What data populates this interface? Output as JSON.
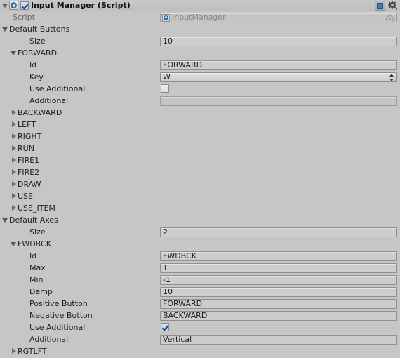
{
  "header": {
    "title": "Input Manager (Script)",
    "enabled": true,
    "foldout_open": true,
    "script_icon": "script-icon",
    "help_icon": "help-icon",
    "gear_icon": "gear-icon"
  },
  "script_row": {
    "label": "Script",
    "value": "InputManager",
    "disabled": true
  },
  "default_buttons": {
    "label": "Default Buttons",
    "size_label": "Size",
    "size_value": "10",
    "expanded_entry": {
      "name": "FORWARD",
      "fields": [
        {
          "label": "Id",
          "value": "FORWARD",
          "type": "text",
          "disabled": false
        },
        {
          "label": "Key",
          "value": "W",
          "type": "popup",
          "disabled": false
        },
        {
          "label": "Use Additional",
          "value": false,
          "type": "checkbox",
          "disabled": false
        },
        {
          "label": "Additional",
          "value": "",
          "type": "text",
          "disabled": true
        }
      ]
    },
    "collapsed_entries": [
      "BACKWARD",
      "LEFT",
      "RIGHT",
      "RUN",
      "FIRE1",
      "FIRE2",
      "DRAW",
      "USE",
      "USE_ITEM"
    ]
  },
  "default_axes": {
    "label": "Default Axes",
    "size_label": "Size",
    "size_value": "2",
    "expanded_entry": {
      "name": "FWDBCK",
      "fields": [
        {
          "label": "Id",
          "value": "FWDBCK",
          "type": "text"
        },
        {
          "label": "Max",
          "value": "1",
          "type": "text"
        },
        {
          "label": "Min",
          "value": "-1",
          "type": "text"
        },
        {
          "label": "Damp",
          "value": "10",
          "type": "text"
        },
        {
          "label": "Positive Button",
          "value": "FORWARD",
          "type": "text"
        },
        {
          "label": "Negative Button",
          "value": "BACKWARD",
          "type": "text"
        },
        {
          "label": "Use Additional",
          "value": true,
          "type": "checkbox"
        },
        {
          "label": "Additional",
          "value": "Vertical",
          "type": "text"
        }
      ]
    },
    "collapsed_entries": [
      "RGTLFT"
    ]
  },
  "colors": {
    "background": "#c6c6c6",
    "field_bg": "#cdcdcd",
    "field_border": "#8f8f8f",
    "accent": "#3d7fc1",
    "check": "#1b3d70"
  }
}
